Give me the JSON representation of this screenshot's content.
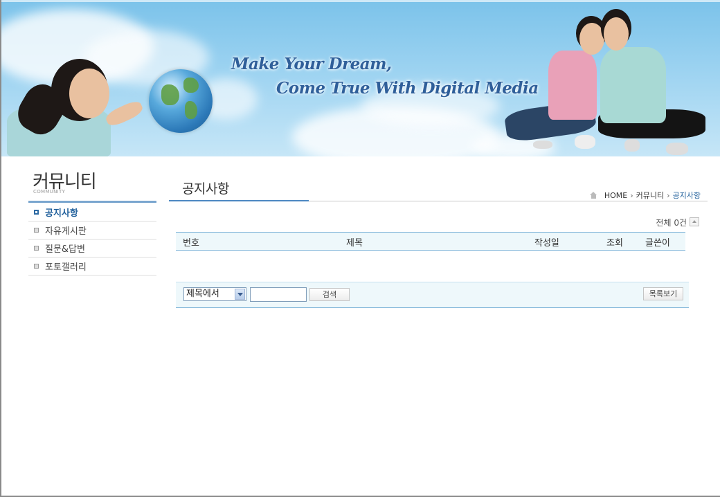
{
  "banner": {
    "slogan_line1": "Make Your Dream,",
    "slogan_line2": "Come True With Digital Media"
  },
  "sidebar": {
    "title": "커뮤니티",
    "subtitle": "COMMUNITY",
    "items": [
      {
        "label": "공지사항",
        "active": true
      },
      {
        "label": "자유게시판",
        "active": false
      },
      {
        "label": "질문&답변",
        "active": false
      },
      {
        "label": "포토갤러리",
        "active": false
      }
    ]
  },
  "main": {
    "title": "공지사항",
    "breadcrumb": [
      "HOME",
      "커뮤니티",
      "공지사항"
    ],
    "total": "전체 0건",
    "table": {
      "headers": [
        "번호",
        "제목",
        "작성일",
        "조회",
        "글쓴이"
      ],
      "rows": []
    },
    "search": {
      "select_value": "제목에서",
      "input_value": "",
      "search_button": "검색",
      "list_button": "목록보기"
    }
  },
  "colors": {
    "accent": "#1f5f9b",
    "table_header_bg": "#eef8fb",
    "table_border": "#7fb4d8",
    "banner_sky": "#9dd3f1"
  }
}
